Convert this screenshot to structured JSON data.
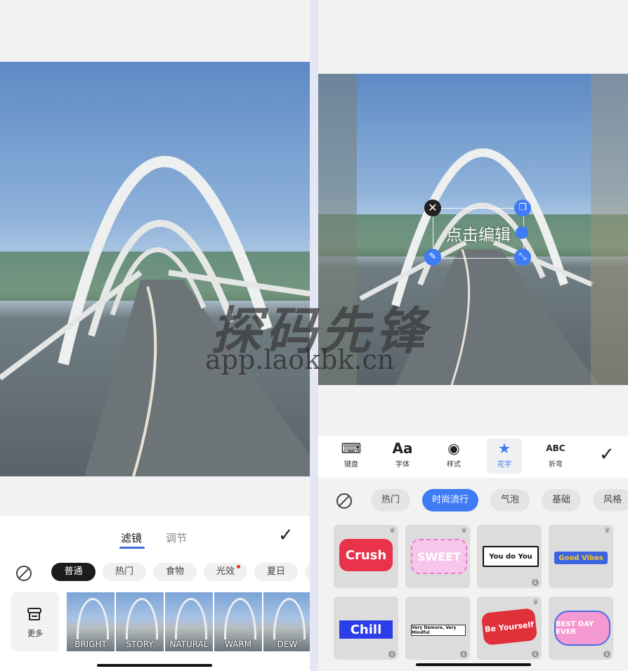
{
  "left": {
    "tabs": [
      {
        "label": "滤镜",
        "active": true
      },
      {
        "label": "调节",
        "active": false
      }
    ],
    "filter_categories": [
      {
        "label": "普通",
        "active": true
      },
      {
        "label": "热门",
        "active": false
      },
      {
        "label": "食物",
        "active": false
      },
      {
        "label": "光效",
        "active": false,
        "dot": true
      },
      {
        "label": "夏日",
        "active": false
      }
    ],
    "more_label": "更多",
    "filters": [
      "BRIGHT",
      "STORY",
      "NATURAL",
      "WARM",
      "DEW"
    ]
  },
  "right": {
    "text_box": {
      "text": "点击编辑"
    },
    "tools": [
      {
        "label": "键盘",
        "icon": "keyboard-icon",
        "glyph": "⌨",
        "active": false
      },
      {
        "label": "字体",
        "icon": "font-icon",
        "glyph": "Aa",
        "active": false
      },
      {
        "label": "样式",
        "icon": "palette-icon",
        "glyph": "◉",
        "active": false
      },
      {
        "label": "花字",
        "icon": "star-bookmark-icon",
        "glyph": "★",
        "active": true
      },
      {
        "label": "折弯",
        "icon": "curve-text-icon",
        "glyph": "ABC",
        "active": false
      }
    ],
    "sticker_categories": [
      {
        "label": "热门",
        "active": false
      },
      {
        "label": "时尚流行",
        "active": true
      },
      {
        "label": "气泡",
        "active": false
      },
      {
        "label": "基础",
        "active": false
      },
      {
        "label": "风格",
        "active": false
      }
    ],
    "stickers": [
      {
        "text": "Crush",
        "bg": "#e8334a",
        "color": "#ffffff"
      },
      {
        "text": "SWEET",
        "bg": "#f7c6ea",
        "color": "#ffffff"
      },
      {
        "text": "You do You",
        "bg": "#ffffff",
        "color": "#111111"
      },
      {
        "text": "Good Vibes",
        "bg": "#3d63e0",
        "color": "#ffcc22"
      },
      {
        "text": "Chill",
        "bg": "#2a3de8",
        "color": "#ffffff"
      },
      {
        "text": "Very Demure, Very Mindful",
        "bg": "#ffffff",
        "color": "#111111"
      },
      {
        "text": "Be Yourself",
        "bg": "#e0303a",
        "color": "#ffffff"
      },
      {
        "text": "BEST DAY EVER",
        "bg": "#f59ad1",
        "color": "#ffffff"
      }
    ]
  },
  "watermark": {
    "title": "探码先锋",
    "url": "app.laokbk.cn"
  },
  "colors": {
    "accent": "#3e7bf5",
    "dark_chip": "#1c1c1c"
  }
}
